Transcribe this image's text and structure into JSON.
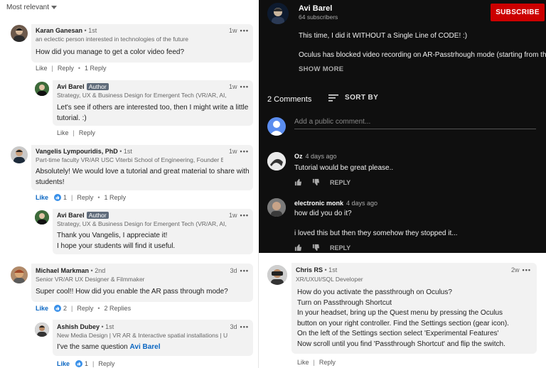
{
  "linkedin": {
    "sort_label": "Most relevant",
    "comments": [
      {
        "name": "Karan Ganesan",
        "degree": "• 1st",
        "headline": "an eclectic person interested in technologies of the future",
        "time": "1w",
        "text": "How did you manage to get a color video feed?",
        "like": "Like",
        "reply": "Reply",
        "replies": "1 Reply"
      },
      {
        "name": "Avi Barel",
        "badge": "Author",
        "headline": "Strategy, UX & Business Design for Emergent Tech (VR/AR, AI, ...",
        "time": "1w",
        "text_lines": [
          "Let's see if others are interested too, then I might write a little",
          "tutorial. :)"
        ],
        "like": "Like",
        "reply": "Reply"
      },
      {
        "name": "Vangelis Lympouridis, PhD",
        "degree": "• 1st",
        "headline": "Part-time faculty VR/AR USC Viterbi School of Engineering, Founder EN...",
        "time": "1w",
        "text_lines": [
          "Absolutely! We would love a tutorial and great material to share with",
          "students!"
        ],
        "like": "Like",
        "reaction_count": "1",
        "reply": "Reply",
        "replies": "1 Reply"
      },
      {
        "name": "Avi Barel",
        "badge": "Author",
        "headline": "Strategy, UX & Business Design for Emergent Tech (VR/AR, AI, ...",
        "time": "1w",
        "text_lines": [
          "Thank you Vangelis, I appreciate it!",
          "I hope your students will find it useful."
        ]
      },
      {
        "name": "Michael Markman",
        "degree": "• 2nd",
        "headline": "Senior VR/AR UX Designer & Filmmaker",
        "time": "3d",
        "text": "Super cool!! How did you enable the AR pass through mode?",
        "like": "Like",
        "reaction_count": "2",
        "reply": "Reply",
        "replies": "2 Replies"
      },
      {
        "name": "Ashish Dubey",
        "degree": "• 1st",
        "headline": "New Media Design | VR AR & Interactive spatial installations | U...",
        "time": "3d",
        "text_prefix": "I've the same question",
        "mention": "Avi Barel",
        "like": "Like",
        "reaction_count": "1",
        "reply": "Reply"
      }
    ],
    "chris": {
      "name": "Chris RS",
      "degree": "• 1st",
      "headline": "XR/UXUI/SQL Developer",
      "time": "2w",
      "lines": [
        "How do you activate the passthrough on Oculus?",
        "Turn on Passthrough Shortcut",
        "In your headset, bring up the Quest menu by pressing the Oculus",
        "button on your right controller. Find the Settings section (gear icon).",
        "On the left of the Settings section select 'Experimental Features'",
        "Now scroll until you find 'Passthrough Shortcut' and flip the switch."
      ],
      "like": "Like",
      "reply": "Reply"
    }
  },
  "youtube": {
    "channel": "Avi Barel",
    "subscribers": "64 subscribers",
    "subscribe": "SUBSCRIBE",
    "desc1": "This time, I did it WITHOUT a Single Line of CODE! :)",
    "desc2": "Oculus has blocked video recording on AR-Passtrhough mode (starting from the",
    "show_more": "SHOW MORE",
    "comment_count": "2 Comments",
    "sort_by": "SORT BY",
    "add_placeholder": "Add a public comment...",
    "comments": [
      {
        "name": "Oz",
        "time": "4 days ago",
        "text": "Tutorial would be great please..",
        "reply": "REPLY"
      },
      {
        "name": "electronic monk",
        "time": "4 days ago",
        "text": "how did you do it?",
        "text2": "i loved this but then they somehow they stopped it...",
        "reply": "REPLY"
      }
    ]
  }
}
